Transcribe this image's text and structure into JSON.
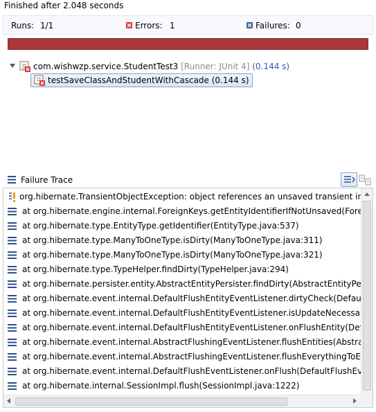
{
  "status": "Finished after 2.048 seconds",
  "counters": {
    "runs_label": "Runs:",
    "runs_value": "1/1",
    "errors_label": "Errors:",
    "errors_value": "1",
    "failures_label": "Failures:",
    "failures_value": "0"
  },
  "progress": {
    "fraction": 1.0,
    "color": "#a7373a",
    "state": "error"
  },
  "tree": {
    "suite": {
      "name": "com.wishwzp.service.StudentTest3",
      "runner": "[Runner: JUnit 4]",
      "time": "(0.144 s)"
    },
    "test": {
      "label": "testSaveClassAndStudentWithCascade (0.144 s)"
    }
  },
  "trace": {
    "title": "Failure Trace",
    "lines": [
      "org.hibernate.TransientObjectException: object references an unsaved transient insta",
      "at org.hibernate.engine.internal.ForeignKeys.getEntityIdentifierIfNotUnsaved(Foreign",
      "at org.hibernate.type.EntityType.getIdentifier(EntityType.java:537)",
      "at org.hibernate.type.ManyToOneType.isDirty(ManyToOneType.java:311)",
      "at org.hibernate.type.ManyToOneType.isDirty(ManyToOneType.java:321)",
      "at org.hibernate.type.TypeHelper.findDirty(TypeHelper.java:294)",
      "at org.hibernate.persister.entity.AbstractEntityPersister.findDirty(AbstractEntityPersiste",
      "at org.hibernate.event.internal.DefaultFlushEntityEventListener.dirtyCheck(DefaultFlush",
      "at org.hibernate.event.internal.DefaultFlushEntityEventListener.isUpdateNecessary(De",
      "at org.hibernate.event.internal.DefaultFlushEntityEventListener.onFlushEntity(DefaultFlu",
      "at org.hibernate.event.internal.AbstractFlushingEventListener.flushEntities(AbstractFlus",
      "at org.hibernate.event.internal.AbstractFlushingEventListener.flushEverythingToExecut",
      "at org.hibernate.event.internal.DefaultFlushEventListener.onFlush(DefaultFlushEventLis",
      "at org.hibernate.internal.SessionImpl.flush(SessionImpl.java:1222)"
    ]
  },
  "icons": {
    "error": "error-icon",
    "failure": "failure-icon",
    "stack_frame": "stack-frame-icon",
    "exception": "exception-icon",
    "filter": "filter-stack-icon",
    "compare": "compare-icon"
  }
}
